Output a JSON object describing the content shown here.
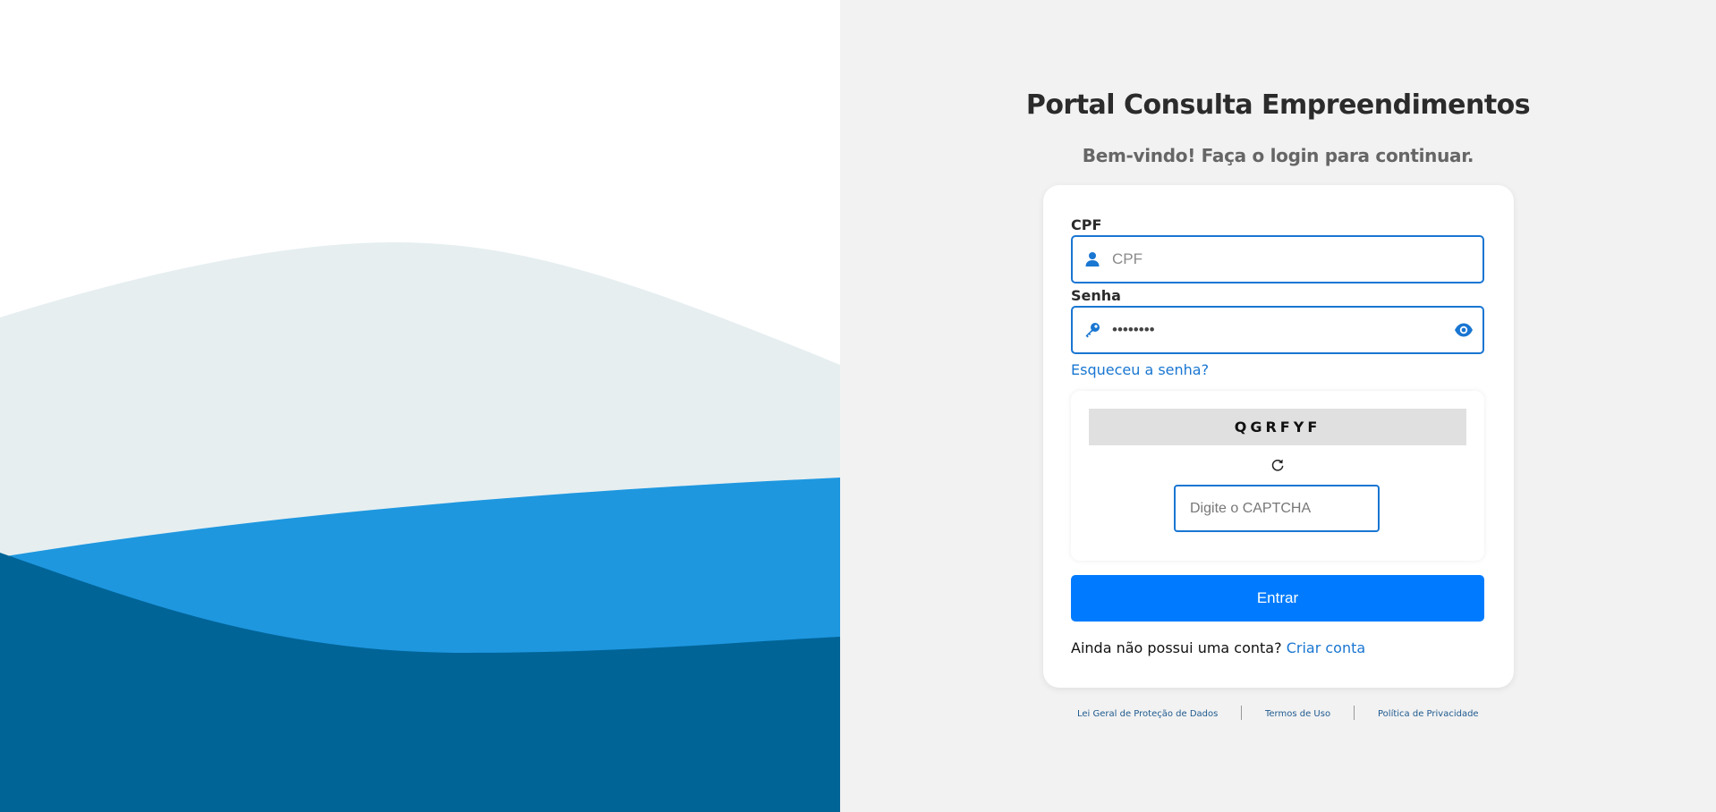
{
  "header": {
    "title": "Portal Consulta Empreendimentos",
    "subtitle": "Bem-vindo! Faça o login para continuar."
  },
  "form": {
    "cpf_label": "CPF",
    "cpf_placeholder": "CPF",
    "cpf_value": "",
    "password_label": "Senha",
    "password_value": "12345678",
    "forgot_link": "Esqueceu a senha?",
    "captcha_code": "QGRFYF",
    "captcha_placeholder": "Digite o CAPTCHA",
    "captcha_value": "",
    "submit_label": "Entrar",
    "signup_text": "Ainda não possui uma conta?",
    "signup_link": "Criar conta"
  },
  "footer": {
    "links": [
      "Lei Geral de Proteção de Dados",
      "Termos de Uso",
      "Política de Privacidade"
    ]
  },
  "icons": {
    "cpf_field": "user-icon",
    "password_field": "key-icon",
    "password_toggle": "eye-icon",
    "captcha_refresh": "refresh-icon"
  },
  "colors": {
    "accent": "#1976d2",
    "button": "#007bff",
    "wave_light": "#e6eef0",
    "wave_mid": "#1e97df",
    "wave_dark": "#006497",
    "right_background": "#f2f2f2"
  }
}
